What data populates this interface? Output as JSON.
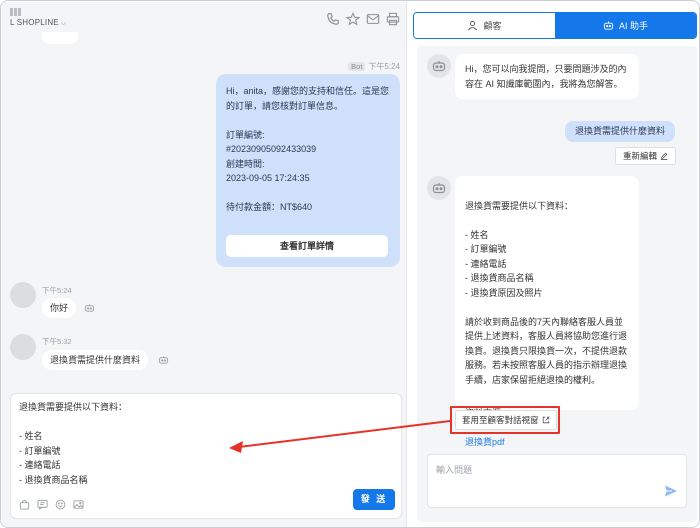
{
  "left": {
    "shop_name": "L SHOPLINE",
    "bot_meta_badge": "Bot",
    "bot_meta_time": "下午5:24",
    "bot_message": "Hi，anita，感謝您的支持和信任。這是您的訂單，請您核對訂單信息。\n\n訂單編號:\n#20230905092433039\n創建時間:\n2023-09-05 17:24:35\n\n待付款金額：NT$640",
    "order_button": "查看訂單詳情",
    "messages": [
      {
        "time": "下午5:24",
        "text": "你好"
      },
      {
        "time": "下午5:32",
        "text": "退換貨需提供什麼資料"
      }
    ],
    "composer_text": "退換貨需要提供以下資料：\n\n- 姓名\n- 訂單編號\n- 連絡電話\n- 退換貨商品名稱",
    "send_button": "發 送"
  },
  "right": {
    "tab_customer": "顧客",
    "tab_ai": "AI 助手",
    "greeting": "Hi，您可以向我提問，只要問題涉及的內容在 AI 知識庫範圍內，我將為您解答。",
    "user_question": "退換貨需提供什麼資料",
    "reedit_label": "重新編輯",
    "answer": "退換貨需要提供以下資料：\n\n- 姓名\n- 訂單編號\n- 連絡電話\n- 退換貨商品名稱\n- 退換貨原因及照片\n\n請於收到商品後的7天內聯絡客服人員並提供上述資料，客服人員將協助您進行退換貨。退換貨只限換貨一次，不提供退款服務。若未按照客服人員的指示辦理退換手續，店家保留拒絕退換的權利。",
    "source_title": "資料來源",
    "source_link": "退換貨pdf",
    "apply_button": "套用至顧客對話視窗",
    "input_placeholder": "輸入問題"
  },
  "colors": {
    "primary": "#1478ea",
    "bot_bubble": "#cfe0fb",
    "highlight": "#e5332a"
  },
  "icons": [
    "phone-icon",
    "star-icon",
    "mail-icon",
    "printer-icon",
    "person-icon",
    "robot-icon",
    "edit-icon",
    "external-link-icon",
    "send-icon",
    "bag-icon",
    "quick-reply-icon",
    "emoji-icon",
    "image-icon"
  ]
}
